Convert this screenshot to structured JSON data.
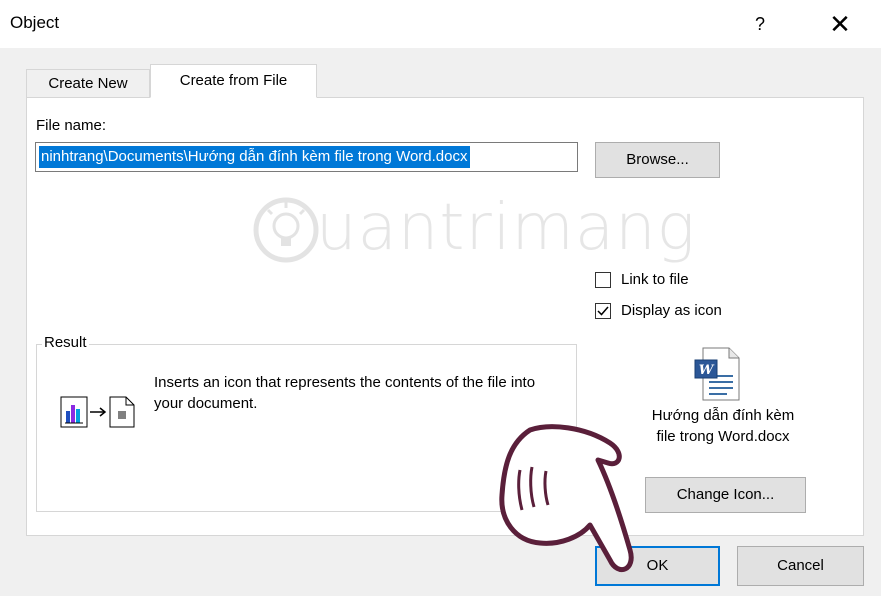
{
  "window": {
    "title": "Object",
    "help_label": "?",
    "close_label": "✕"
  },
  "tabs": [
    {
      "label": "Create New",
      "selected": false
    },
    {
      "label": "Create from File",
      "selected": true
    }
  ],
  "file_name": {
    "label": "File name:",
    "value": "ninhtrang\\Documents\\Hướng dẫn đính kèm file trong Word.docx"
  },
  "browse_label": "Browse...",
  "watermark": "uantrimang",
  "options": {
    "link_to_file": {
      "label": "Link to file",
      "checked": false
    },
    "display_as_icon": {
      "label": "Display as icon",
      "checked": true
    }
  },
  "result": {
    "title": "Result",
    "text": "Inserts an icon that represents the contents of the file into your document."
  },
  "icon_preview": {
    "icon": "word-document-icon",
    "caption_line1": "Hướng dẫn đính kèm",
    "caption_line2": "file trong Word.docx"
  },
  "change_icon_label": "Change Icon...",
  "ok_label": "OK",
  "cancel_label": "Cancel",
  "colors": {
    "accent": "#0078d7",
    "dialog_bg": "#f0f0f0",
    "button_bg": "#e1e1e1"
  }
}
